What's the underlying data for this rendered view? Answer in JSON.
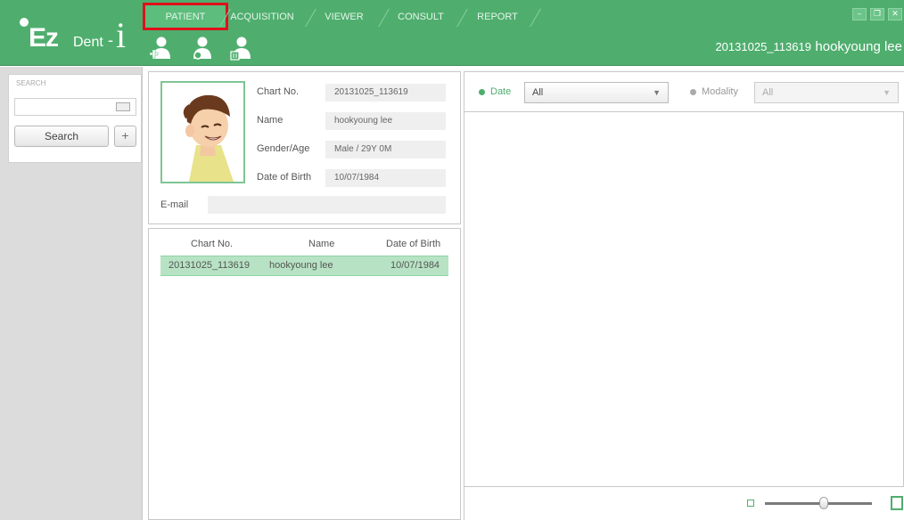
{
  "app": {
    "logo_ez": "Ez",
    "logo_dent": "Dent",
    "logo_dash": "-",
    "logo_i": "i"
  },
  "tabs": [
    {
      "label": "PATIENT",
      "active": true
    },
    {
      "label": "ACQUISITION",
      "active": false
    },
    {
      "label": "VIEWER",
      "active": false
    },
    {
      "label": "CONSULT",
      "active": false
    },
    {
      "label": "REPORT",
      "active": false
    }
  ],
  "toolbar": {
    "icons": [
      "add-patient-icon",
      "edit-patient-icon",
      "delete-patient-icon"
    ]
  },
  "window_controls": {
    "minimize": "–",
    "restore": "❐",
    "close": "✕"
  },
  "header_patient": {
    "chart_no": "20131025_113619",
    "name": "hookyoung lee"
  },
  "search": {
    "label": "SEARCH",
    "placeholder": "",
    "button_label": "Search",
    "plus_label": "+"
  },
  "patient_info": {
    "chart_no_label": "Chart No.",
    "chart_no": "20131025_113619",
    "name_label": "Name",
    "name": "hookyoung lee",
    "gender_age_label": "Gender/Age",
    "gender_age": "Male / 29Y 0M",
    "dob_label": "Date of Birth",
    "dob": "10/07/1984",
    "email_label": "E-mail",
    "email": ""
  },
  "patient_list": {
    "headers": [
      "Chart No.",
      "Name",
      "Date of Birth"
    ],
    "rows": [
      {
        "chart_no": "20131025_113619",
        "name": "hookyoung lee",
        "dob": "10/07/1984",
        "selected": true
      }
    ]
  },
  "filters": {
    "date_label": "Date",
    "date_value": "All",
    "date_active": true,
    "modality_label": "Modality",
    "modality_value": "All",
    "modality_active": false
  },
  "zoom": {
    "level_fraction": 0.55
  },
  "colors": {
    "brand_green": "#4fae6e",
    "highlight_red": "#e0101a",
    "row_selected": "#b7e3c4",
    "sidebar_gray": "#dcdcdc"
  }
}
